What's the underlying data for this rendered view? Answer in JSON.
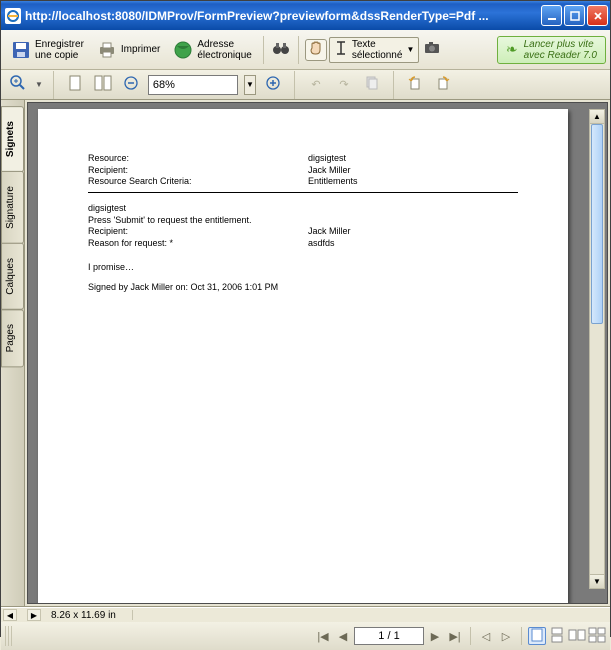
{
  "window": {
    "title": "http://localhost:8080/IDMProv/FormPreview?previewform&dssRenderType=Pdf ..."
  },
  "toolbar": {
    "save_label": "Enregistrer\nune copie",
    "print_label": "Imprimer",
    "address_label": "Adresse\nélectronique",
    "text_select_label": "Texte\nsélectionné"
  },
  "promo": {
    "line1": "Lancer plus vite",
    "line2": "avec Reader 7.0"
  },
  "zoom": {
    "value": "68%"
  },
  "nav_tabs": [
    "Signets",
    "Signature",
    "Calques",
    "Pages"
  ],
  "document": {
    "header": {
      "rows": [
        {
          "label": "Resource:",
          "value": "digsigtest"
        },
        {
          "label": "Recipient:",
          "value": "Jack Miller"
        },
        {
          "label": "Resource Search Criteria:",
          "value": "Entitlements"
        }
      ]
    },
    "body": {
      "title": "digsigtest",
      "instruction": "Press 'Submit' to request the entitlement.",
      "rows": [
        {
          "label": "Recipient:",
          "value": "Jack Miller"
        },
        {
          "label": "Reason for request: *",
          "value": "asdfds"
        }
      ],
      "promise": "I promise…",
      "signed": "Signed by Jack Miller on: Oct 31, 2006 1:01 PM"
    }
  },
  "status": {
    "dimensions": "8.26 x 11.69 in"
  },
  "pager": {
    "display": "1 / 1"
  }
}
